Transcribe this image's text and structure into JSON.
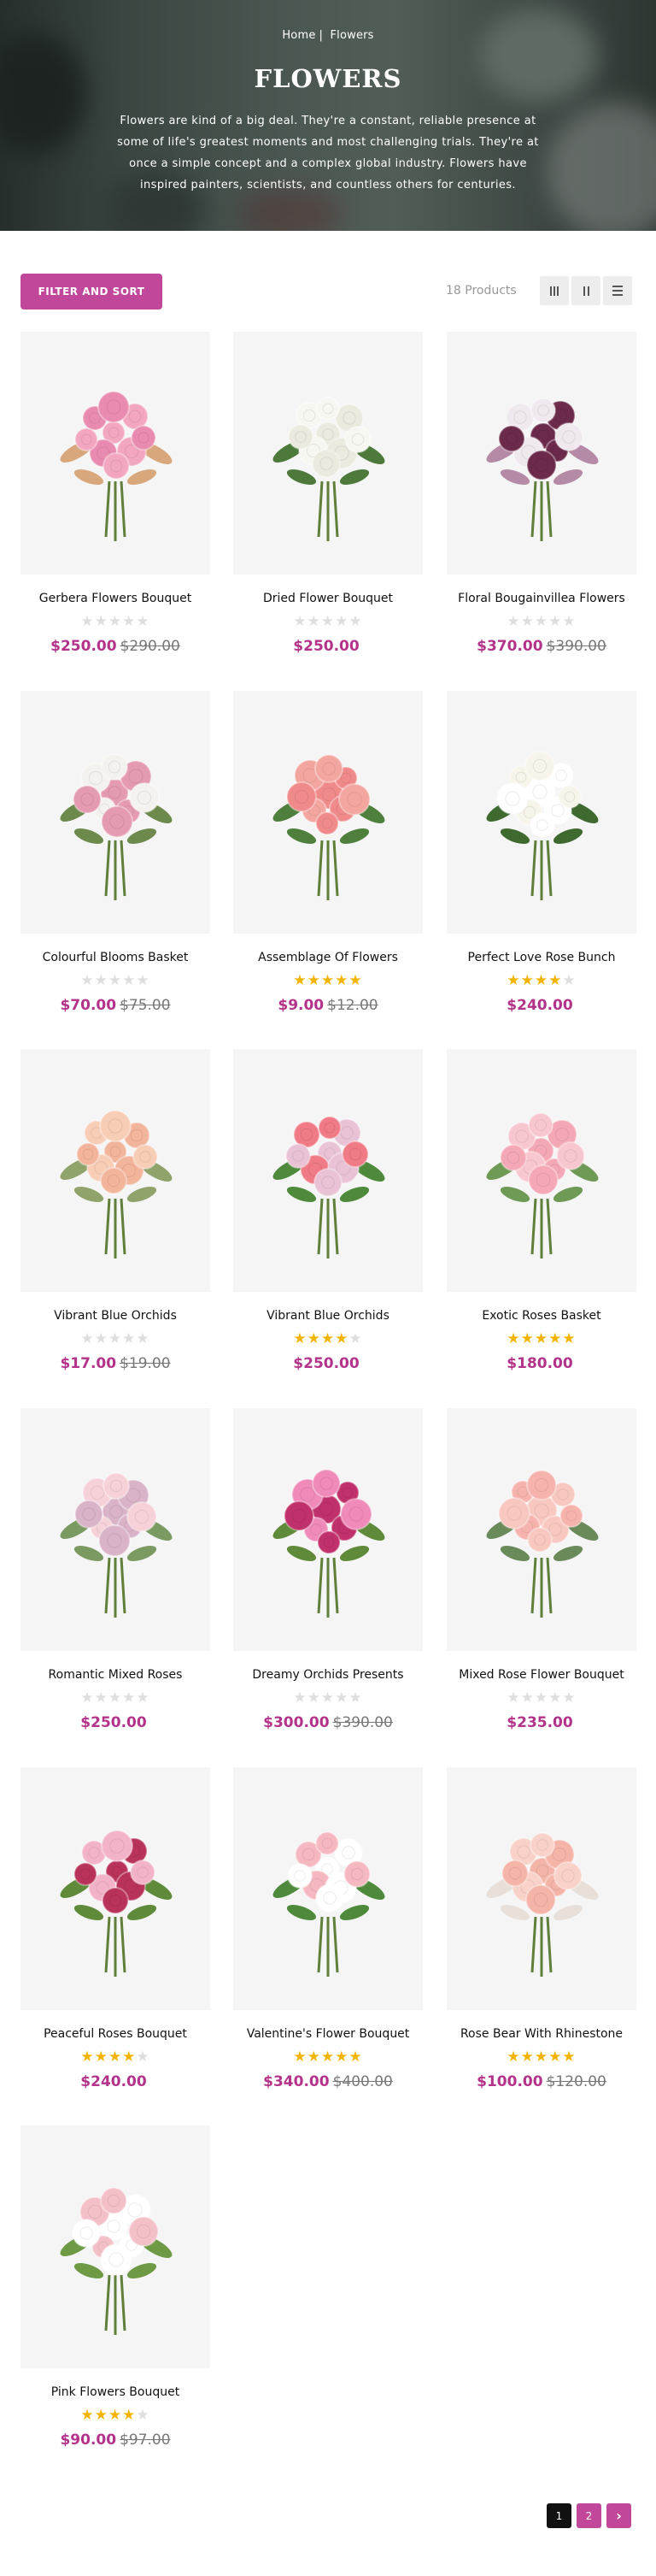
{
  "breadcrumb": {
    "home": "Home",
    "separator": "|",
    "current": "Flowers"
  },
  "page": {
    "title": "FLOWERS",
    "description": "Flowers are kind of a big deal. They're a constant, reliable presence at some of life's greatest moments and most challenging trials. They're at once a simple concept and a complex global industry. Flowers have inspired painters, scientists, and countless others for centuries."
  },
  "toolbar": {
    "filter_label": "FILTER AND SORT",
    "product_count": "18 Products",
    "views": [
      "grid-3-icon",
      "grid-2-icon",
      "list-icon"
    ]
  },
  "colors": {
    "accent": "#c0479a",
    "price": "#b3338a",
    "star": "#f2b400"
  },
  "products": [
    {
      "name": "Gerbera Flowers Bouquet",
      "rating": 0,
      "price": "$250.00",
      "old_price": "$290.00",
      "palette": [
        "#f2a6c0",
        "#e98bb0",
        "#d9a77c"
      ]
    },
    {
      "name": "Dried Flower Bouquet",
      "rating": 0,
      "price": "$250.00",
      "old_price": "",
      "palette": [
        "#f7f7f2",
        "#eaeadf",
        "#4d7a3a"
      ]
    },
    {
      "name": "Floral Bougainvillea Flowers",
      "rating": 0,
      "price": "$370.00",
      "old_price": "$390.00",
      "palette": [
        "#6b2a4a",
        "#efe9ef",
        "#b58aa6"
      ]
    },
    {
      "name": "Colourful Blooms Basket",
      "rating": 0,
      "price": "$70.00",
      "old_price": "$75.00",
      "palette": [
        "#f4f2ee",
        "#e49ab0",
        "#6d8a4c"
      ]
    },
    {
      "name": "Assemblage Of Flowers",
      "rating": 5,
      "price": "$9.00",
      "old_price": "$12.00",
      "palette": [
        "#f08a8a",
        "#f3a6a0",
        "#4f7f3c"
      ]
    },
    {
      "name": "Perfect Love Rose Bunch",
      "rating": 4,
      "price": "$240.00",
      "old_price": "",
      "palette": [
        "#f7f5ea",
        "#ffffff",
        "#3f6a2f"
      ]
    },
    {
      "name": "Vibrant Blue Orchids",
      "rating": 0,
      "price": "$17.00",
      "old_price": "$19.00",
      "palette": [
        "#f2b49a",
        "#f7cdb6",
        "#8fa36a"
      ]
    },
    {
      "name": "Vibrant Blue Orchids",
      "rating": 4,
      "price": "$250.00",
      "old_price": "",
      "palette": [
        "#f07a86",
        "#e9c2d6",
        "#4f8a3c"
      ]
    },
    {
      "name": "Exotic Roses Basket",
      "rating": 5,
      "price": "$180.00",
      "old_price": "",
      "palette": [
        "#f4a8b6",
        "#f8c6cf",
        "#6f9a55"
      ]
    },
    {
      "name": "Romantic Mixed Roses",
      "rating": 0,
      "price": "$250.00",
      "old_price": "",
      "palette": [
        "#f6d2d8",
        "#d9b3c8",
        "#7b9a62"
      ]
    },
    {
      "name": "Dreamy Orchids Presents",
      "rating": 0,
      "price": "$300.00",
      "old_price": "$390.00",
      "palette": [
        "#c0306a",
        "#f08ab8",
        "#5f8a3a"
      ]
    },
    {
      "name": "Mixed Rose Flower Bouquet",
      "rating": 0,
      "price": "$235.00",
      "old_price": "",
      "palette": [
        "#f6b3ad",
        "#f8c8c0",
        "#6b8a5a"
      ]
    },
    {
      "name": "Peaceful Roses Bouquet",
      "rating": 4,
      "price": "$240.00",
      "old_price": "",
      "palette": [
        "#b8325a",
        "#f2b3c8",
        "#5f8a3a"
      ]
    },
    {
      "name": "Valentine's Flower Bouquet",
      "rating": 5,
      "price": "$340.00",
      "old_price": "$400.00",
      "palette": [
        "#f6b8c0",
        "#ffffff",
        "#4f8a3c"
      ]
    },
    {
      "name": "Rose Bear With Rhinestone",
      "rating": 5,
      "price": "$100.00",
      "old_price": "$120.00",
      "palette": [
        "#f4b4a8",
        "#f8d2c8",
        "#e8e0d8"
      ]
    },
    {
      "name": "Pink Flowers Bouquet",
      "rating": 4,
      "price": "$90.00",
      "old_price": "$97.00",
      "palette": [
        "#f4c0c8",
        "#ffffff",
        "#6f9a45"
      ]
    }
  ],
  "pagination": {
    "pages": [
      "1",
      "2"
    ],
    "active": "1",
    "next_icon": "chevron-right-icon",
    "next_label": "›"
  }
}
